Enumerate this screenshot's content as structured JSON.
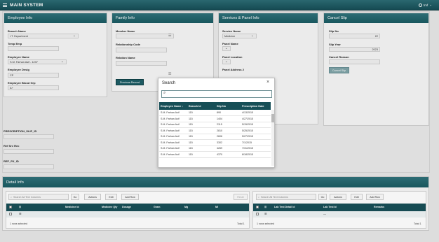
{
  "app": {
    "title": "MAIN SYSTEM",
    "user": "tmf"
  },
  "employee": {
    "heading": "Employee Info",
    "branch_name_label": "Branch Name",
    "branch_name_value": "I.T. Department",
    "temp_emp_label": "Temp Emp",
    "employee_name_label": "Employee Name",
    "employee_name_value": "S.M. Farhan Asif - 1237",
    "employee_desig_label": "Employee Desig",
    "employee_desig_value": "CP",
    "blood_grp_label": "Employee Blood Grp",
    "blood_grp_value": "A+",
    "prescription_slip_id_label": "PRESCRIPTION_SLIP_ID",
    "ref_srv_rec_label": "Ref Srv Rec",
    "ref_fk_id_label": "REF_FK_ID"
  },
  "family": {
    "heading": "Family Info",
    "member_name_label": "Member Name",
    "relationship_code_label": "Relationship Code",
    "relation_name_label": "Relation Name",
    "previous_record_button": "Previous Record"
  },
  "services": {
    "heading": "Services & Panel Info",
    "service_name_label": "Service Name",
    "service_name_value": "Medicine",
    "panel_name_label": "Panel Name",
    "panel_location_label": "Panel Location",
    "panel_address_label": "Panel Address 2"
  },
  "cancel": {
    "heading": "Cancel Slip",
    "slip_no_label": "Slip No",
    "slip_no_value": "22",
    "slip_year_label": "Slip Year",
    "slip_year_value": "2023",
    "cancel_reason_label": "Cancel Reason",
    "cancel_slip_button": "Cancel Slip"
  },
  "detail": {
    "heading": "Detail Info",
    "left": {
      "search_placeholder": "Search All Text Columns",
      "go": "Go",
      "actions": "Actions",
      "edit": "Edit",
      "add_row": "Add Row",
      "reset": "Reset",
      "columns": [
        "Medicine Id",
        "Medicine Qty",
        "Dosage",
        "Gram",
        "Mg",
        "Ml"
      ],
      "footer_left": "1 rows selected",
      "footer_right": "Total 1"
    },
    "right": {
      "search_placeholder": "Search All Text Columns",
      "go": "Go",
      "actions": "Actions",
      "edit": "Edit",
      "add_row": "Add Row",
      "columns": [
        "Lab Test Detail Id",
        "Lab Test Id",
        "Remarks"
      ],
      "row_value": "—",
      "footer_left": "1 rows selected",
      "footer_right": "Total 1"
    }
  },
  "search_modal": {
    "title": "Search",
    "close": "×",
    "columns": [
      "Employee Name",
      "Branch Id",
      "Slip No",
      "Prescription Date"
    ],
    "rows": [
      [
        "S.M. Farhan Asif",
        "115",
        "890",
        "4/13/2015"
      ],
      [
        "S.M. Farhan Asif",
        "115",
        "1404",
        "4/27/2015"
      ],
      [
        "S.M. Farhan Asif",
        "115",
        "2115",
        "5/15/2015"
      ],
      [
        "S.M. Farhan Asif",
        "115",
        "2810",
        "5/25/2015"
      ],
      [
        "S.M. Farhan Asif",
        "115",
        "2606",
        "5/27/2015"
      ],
      [
        "S.M. Farhan Asif",
        "115",
        "3302",
        "7/1/2015"
      ],
      [
        "S.M. Farhan Asif",
        "115",
        "4269",
        "7/31/2015"
      ],
      [
        "S.M. Farhan Asif",
        "115",
        "4370",
        "8/18/2015"
      ]
    ]
  }
}
